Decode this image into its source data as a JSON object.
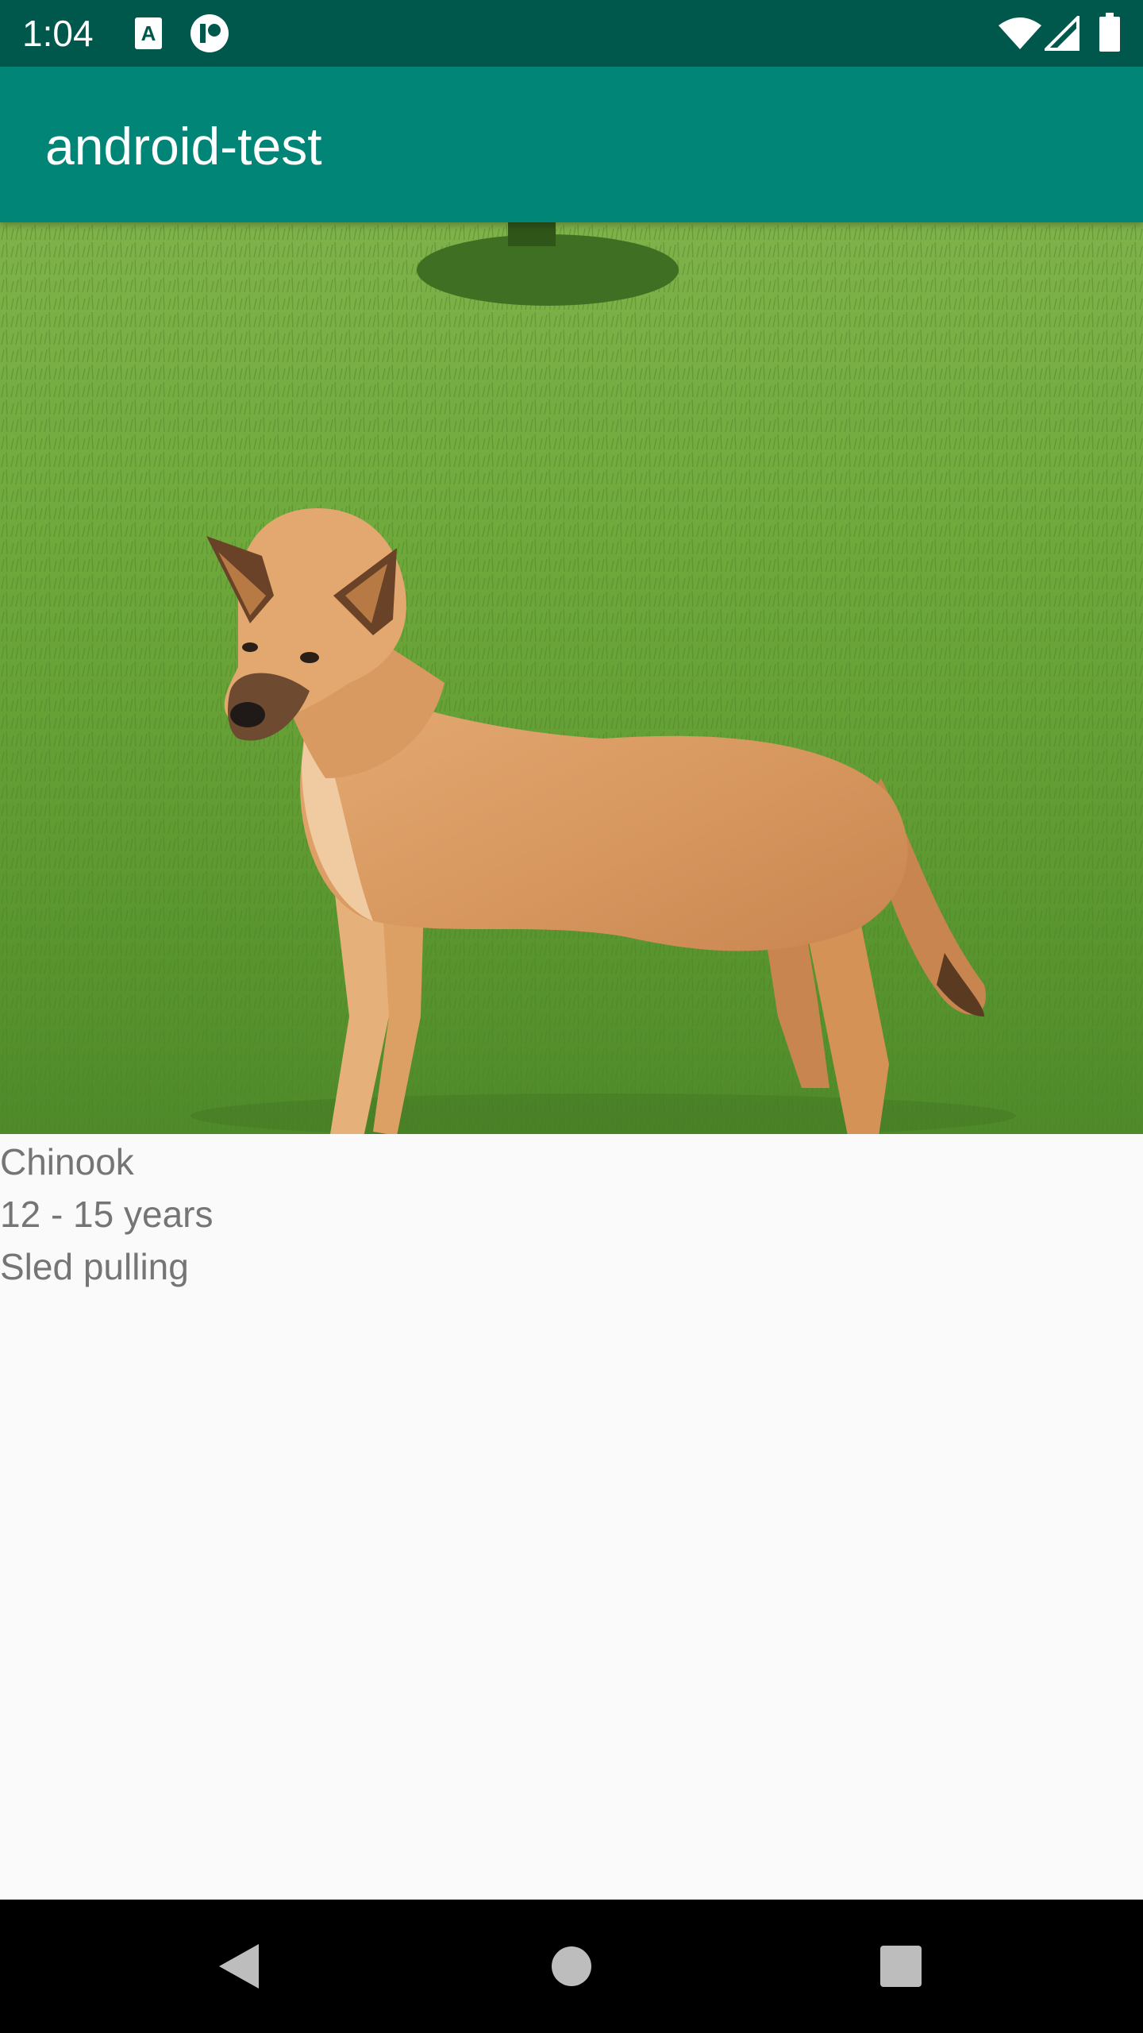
{
  "status_bar": {
    "time": "1:04",
    "icons": [
      "a11y-app-icon",
      "data-app-icon",
      "wifi-icon",
      "signal-icon",
      "battery-icon"
    ]
  },
  "app_bar": {
    "title": "android-test"
  },
  "hero": {
    "image": "dog-photo"
  },
  "details": {
    "breed": "Chinook",
    "lifespan": "12 - 15 years",
    "bred_for": "Sled pulling"
  },
  "nav_bar": {
    "buttons": [
      "back-icon",
      "home-icon",
      "recents-icon"
    ]
  },
  "colors": {
    "status_bar": "#00574b",
    "app_bar": "#008577",
    "background": "#fafafa",
    "text": "#757575",
    "nav_bar": "#000000"
  }
}
